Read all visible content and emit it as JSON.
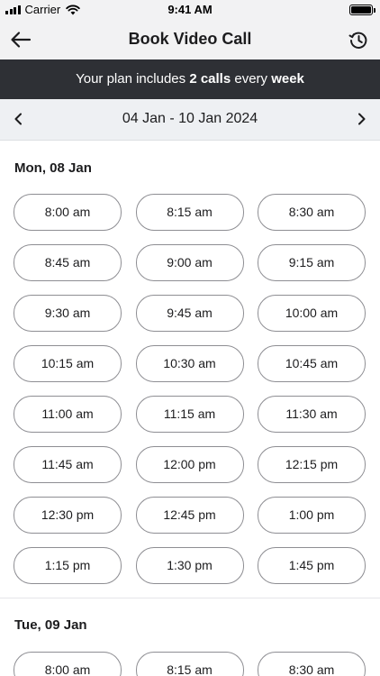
{
  "status_bar": {
    "carrier": "Carrier",
    "time": "9:41 AM",
    "signal_icon": "cellular-signal-icon",
    "wifi_icon": "wifi-icon",
    "battery_icon": "battery-icon",
    "battery_level": 1.0
  },
  "nav": {
    "title": "Book Video Call",
    "back_icon": "arrow-left-icon",
    "history_icon": "history-clock-icon"
  },
  "plan_banner": {
    "prefix": "Your plan includes ",
    "calls": "2 calls",
    "middle": " every ",
    "period": "week",
    "background": "#2e3035"
  },
  "week": {
    "label": "04 Jan - 10 Jan 2024",
    "prev_icon": "chevron-left-icon",
    "next_icon": "chevron-right-icon"
  },
  "days": [
    {
      "title": "Mon, 08 Jan",
      "slots": [
        "8:00 am",
        "8:15 am",
        "8:30 am",
        "8:45 am",
        "9:00 am",
        "9:15 am",
        "9:30 am",
        "9:45 am",
        "10:00 am",
        "10:15 am",
        "10:30 am",
        "10:45 am",
        "11:00 am",
        "11:15 am",
        "11:30 am",
        "11:45 am",
        "12:00 pm",
        "12:15 pm",
        "12:30 pm",
        "12:45 pm",
        "1:00 pm",
        "1:15 pm",
        "1:30 pm",
        "1:45 pm"
      ]
    },
    {
      "title": "Tue, 09 Jan",
      "slots": [
        "8:00 am",
        "8:15 am",
        "8:30 am"
      ]
    }
  ],
  "colors": {
    "header_bg": "#f2f2f3",
    "slot_border": "#8e8e93",
    "text": "#1c1c1e"
  }
}
